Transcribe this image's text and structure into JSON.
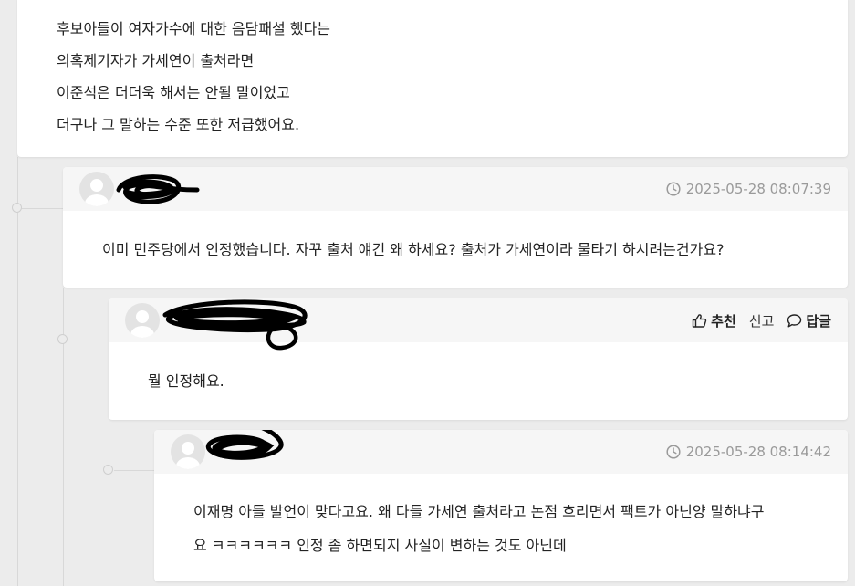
{
  "post": {
    "lines": [
      "후보아들이 여자가수에 대한 음담패설 했다는",
      "의혹제기자가 가세연이 출처라면",
      "이준석은 더더욱 해서는 안될 말이었고",
      "더구나 그 말하는 수준 또한 저급했어요."
    ]
  },
  "comments": [
    {
      "timestamp": "2025-05-28 08:07:39",
      "body": [
        "이미 민주당에서 인정했습니다. 자꾸 출처 얘긴 왜 하세요? 출처가 가세연이라 물타기 하시려는건가요?"
      ]
    },
    {
      "actions": {
        "recommend": "추천",
        "report": "신고",
        "reply": "답글"
      },
      "body": [
        "뭘 인정해요."
      ]
    },
    {
      "timestamp": "2025-05-28 08:14:42",
      "body": [
        "이재명 아들 발언이 맞다고요. 왜 다들 가세연 출처라고 논점 흐리면서 팩트가 아닌양 말하냐구",
        "요 ㅋㅋㅋㅋㅋㅋ 인정 좀 하면되지 사실이 변하는 것도 아닌데"
      ]
    }
  ],
  "icons": {
    "clock": "clock-icon",
    "thumbs_up": "thumbs-up-icon",
    "speech_bubble": "speech-bubble-icon",
    "avatar": "default-avatar-icon"
  },
  "colors": {
    "page_bg": "#ececec",
    "card_bg": "#ffffff",
    "header_bg": "#f6f6f6",
    "muted_text": "#9a9a9a",
    "thread_line": "#d8d8d8"
  }
}
